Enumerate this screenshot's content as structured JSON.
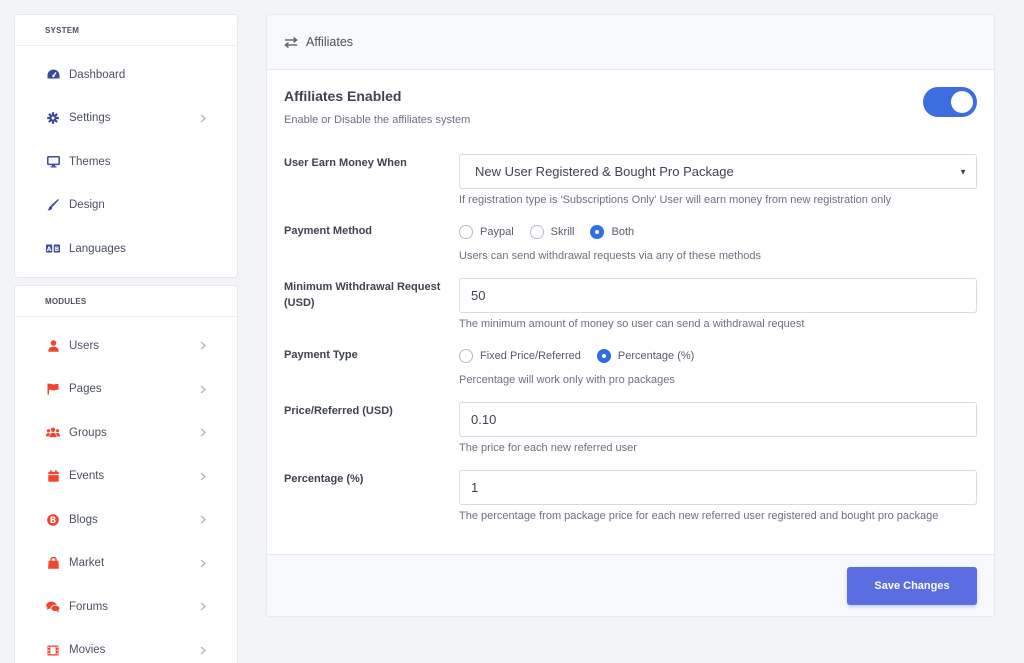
{
  "sidebar": {
    "system": {
      "heading": "SYSTEM",
      "items": [
        {
          "label": "Dashboard",
          "icon": "dashboard-icon"
        },
        {
          "label": "Settings",
          "icon": "gear-icon"
        },
        {
          "label": "Themes",
          "icon": "monitor-icon"
        },
        {
          "label": "Design",
          "icon": "brush-icon"
        },
        {
          "label": "Languages",
          "icon": "language-icon"
        }
      ]
    },
    "modules": {
      "heading": "MODULES",
      "items": [
        {
          "label": "Users",
          "icon": "user-icon"
        },
        {
          "label": "Pages",
          "icon": "flag-icon"
        },
        {
          "label": "Groups",
          "icon": "users-group-icon"
        },
        {
          "label": "Events",
          "icon": "calendar-icon"
        },
        {
          "label": "Blogs",
          "icon": "blog-icon"
        },
        {
          "label": "Market",
          "icon": "shopping-bag-icon"
        },
        {
          "label": "Forums",
          "icon": "comments-icon"
        },
        {
          "label": "Movies",
          "icon": "film-icon"
        }
      ]
    }
  },
  "panel": {
    "title": "Affiliates",
    "title_icon": "exchange-arrows-icon"
  },
  "affiliates": {
    "enabled_title": "Affiliates Enabled",
    "enabled_sub": "Enable or Disable the affiliates system",
    "enabled": true
  },
  "earn": {
    "label": "User Earn Money When",
    "value": "New User Registered & Bought Pro Package",
    "help": "If registration type is 'Subscriptions Only' User will earn money from new registration only"
  },
  "payment_method": {
    "label": "Payment Method",
    "options": [
      "Paypal",
      "Skrill",
      "Both"
    ],
    "selected": "Both",
    "help": "Users can send withdrawal requests via any of these methods"
  },
  "min_withdrawal": {
    "label": "Minimum Withdrawal Request (USD)",
    "value": "50",
    "help": "The minimum amount of money so user can send a withdrawal request"
  },
  "payment_type": {
    "label": "Payment Type",
    "options": [
      "Fixed Price/Referred",
      "Percentage (%)"
    ],
    "selected": "Percentage (%)",
    "help": "Percentage will work only with pro packages"
  },
  "price_referred": {
    "label": "Price/Referred (USD)",
    "value": "0.10",
    "help": "The price for each new referred user"
  },
  "percentage": {
    "label": "Percentage (%)",
    "value": "1",
    "help": "The percentage from package price for each new referred user registered and bought pro package"
  },
  "footer": {
    "save_label": "Save Changes"
  },
  "colors": {
    "accent": "#3c6ee0",
    "button": "#5b6ee1",
    "system_icon": "#3b4a9a",
    "module_icon": "#f0452f"
  }
}
